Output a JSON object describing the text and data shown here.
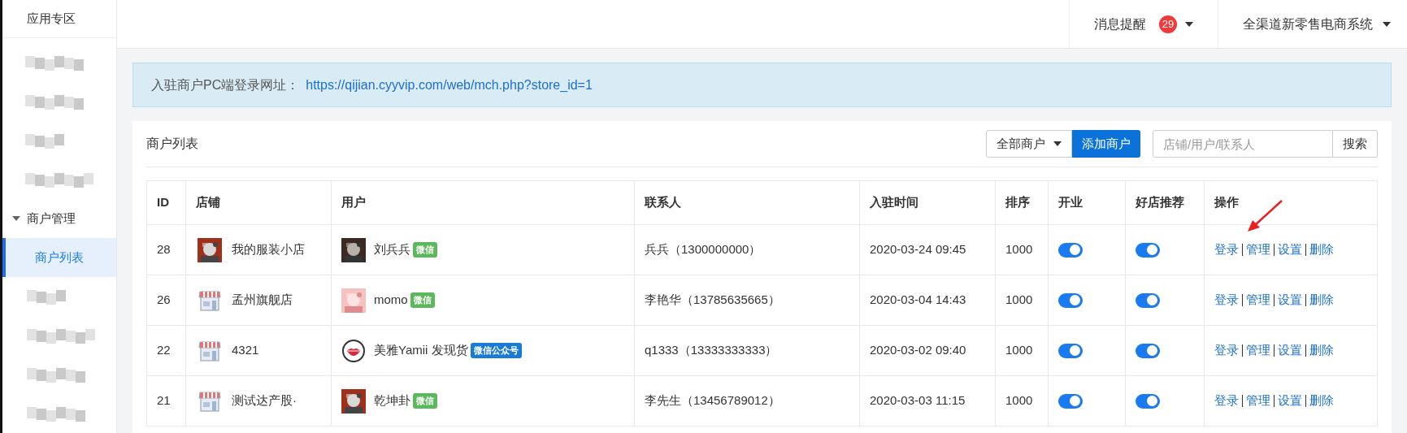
{
  "sidebar": {
    "title": "应用专区",
    "items": [
      {
        "kind": "redacted"
      },
      {
        "kind": "redacted"
      },
      {
        "kind": "redacted"
      },
      {
        "kind": "redacted"
      },
      {
        "kind": "group",
        "label": "商户管理",
        "expanded": true,
        "children": [
          {
            "label": "商户列表",
            "selected": true
          },
          {
            "kind": "redacted"
          },
          {
            "kind": "redacted"
          },
          {
            "kind": "redacted"
          },
          {
            "kind": "redacted"
          }
        ]
      }
    ]
  },
  "header": {
    "notifications": {
      "label": "消息提醒",
      "count": "29"
    },
    "account": "全渠道新零售电商系统"
  },
  "notice": {
    "label": "入驻商户PC端登录网址：",
    "link": "https://qijian.cyyvip.com/web/mch.php?store_id=1"
  },
  "panel": {
    "title": "商户列表",
    "filter": "全部商户",
    "add_button": "添加商户",
    "search": {
      "placeholder": "店铺/用户/联系人",
      "button": "搜索"
    }
  },
  "table": {
    "columns": [
      "ID",
      "店铺",
      "用户",
      "联系人",
      "入驻时间",
      "排序",
      "开业",
      "好店推荐",
      "操作"
    ],
    "rows": [
      {
        "id": "28",
        "store": "我的服装小店",
        "store_logo": {
          "kind": "picture"
        },
        "user": "刘兵兵",
        "avatar": {
          "kind": "picture"
        },
        "tag": {
          "label": "微信",
          "color": "#5cb85c"
        },
        "contact": "兵兵（1300000000）",
        "time": "2020-03-24 09:45",
        "sort": "1000",
        "open": true,
        "recommended": true,
        "actions": [
          "登录",
          "管理",
          "设置",
          "删除"
        ]
      },
      {
        "id": "26",
        "store": "孟州旗舰店",
        "store_logo": {
          "kind": "icon"
        },
        "user": "momo",
        "avatar": {
          "kind": "picture"
        },
        "tag": {
          "label": "微信",
          "color": "#5cb85c"
        },
        "contact": "李艳华（13785635665）",
        "time": "2020-03-04 14:43",
        "sort": "1000",
        "open": true,
        "recommended": true,
        "actions": [
          "登录",
          "管理",
          "设置",
          "删除"
        ]
      },
      {
        "id": "22",
        "store": "4321",
        "store_logo": {
          "kind": "icon"
        },
        "user": "美雅Yamii 发现货",
        "avatar": {
          "kind": "icon"
        },
        "tag": {
          "label": "微信公众号",
          "color": "#1a7bd6"
        },
        "contact": "q1333（13333333333）",
        "time": "2020-03-02 09:40",
        "sort": "1000",
        "open": true,
        "recommended": true,
        "actions": [
          "登录",
          "管理",
          "设置",
          "删除"
        ]
      },
      {
        "id": "21",
        "store": "测试达产股·",
        "store_logo": {
          "kind": "icon"
        },
        "user": "乾坤卦",
        "avatar": {
          "kind": "picture"
        },
        "tag": {
          "label": "微信",
          "color": "#5cb85c"
        },
        "contact": "李先生（13456789012）",
        "time": "2020-03-03 11:15",
        "sort": "1000",
        "open": true,
        "recommended": true,
        "actions": [
          "登录",
          "管理",
          "设置",
          "删除"
        ]
      }
    ]
  }
}
